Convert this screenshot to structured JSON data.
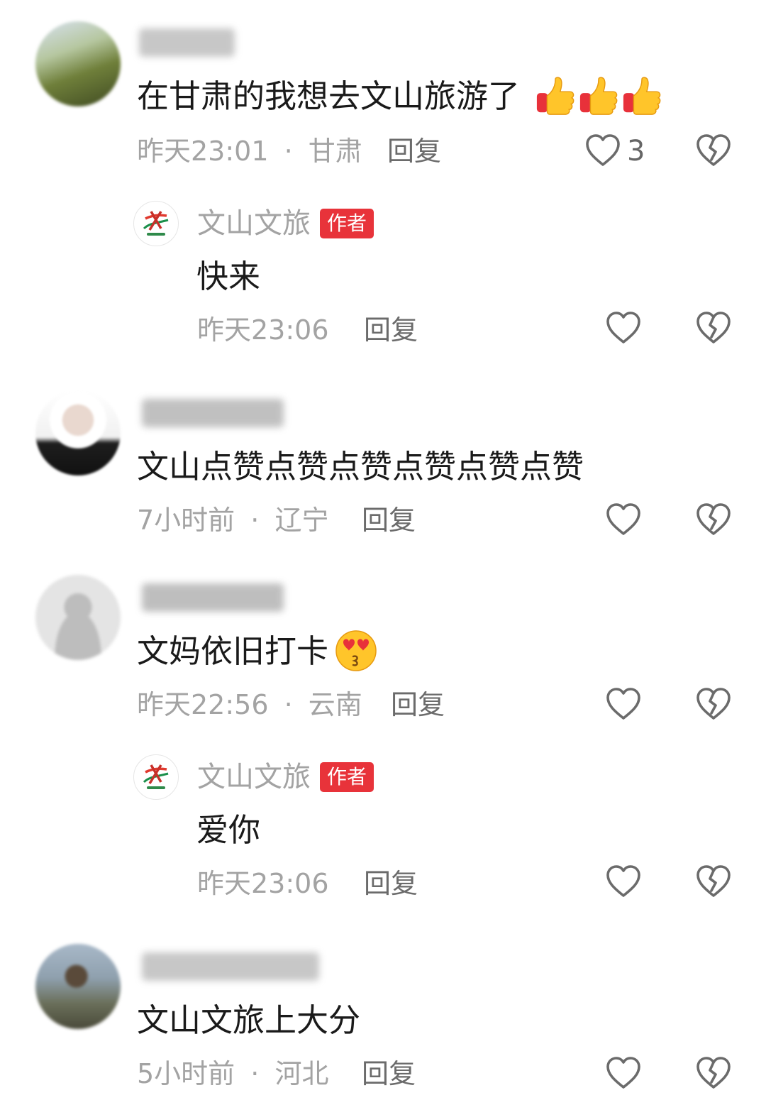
{
  "comments": [
    {
      "text": "在甘肃的我想去文山旅游了",
      "time": "昨天23:01",
      "location": "甘肃",
      "reply_label": "回复",
      "like_count": "3",
      "emojis": [
        "thumbs-up",
        "thumbs-up",
        "thumbs-up"
      ],
      "reply": {
        "author": "文山文旅",
        "badge": "作者",
        "text": "快来",
        "time": "昨天23:06",
        "reply_label": "回复"
      }
    },
    {
      "text": "文山点赞点赞点赞点赞点赞点赞",
      "time": "7小时前",
      "location": "辽宁",
      "reply_label": "回复"
    },
    {
      "text": "文妈依旧打卡",
      "time": "昨天22:56",
      "location": "云南",
      "reply_label": "回复",
      "emojis": [
        "heart-eyes-kiss"
      ],
      "reply": {
        "author": "文山文旅",
        "badge": "作者",
        "text": "爱你",
        "time": "昨天23:06",
        "reply_label": "回复"
      }
    },
    {
      "text": "文山文旅上大分",
      "time": "5小时前",
      "location": "河北",
      "reply_label": "回复"
    }
  ],
  "separator": "·",
  "icons": {
    "like": "heart-outline-icon",
    "dislike": "broken-heart-icon",
    "author_logo": "wenshan-tourism-logo"
  },
  "colors": {
    "text": "#1a1a1a",
    "meta": "#a3a3a3",
    "badge": "#e8333a"
  }
}
